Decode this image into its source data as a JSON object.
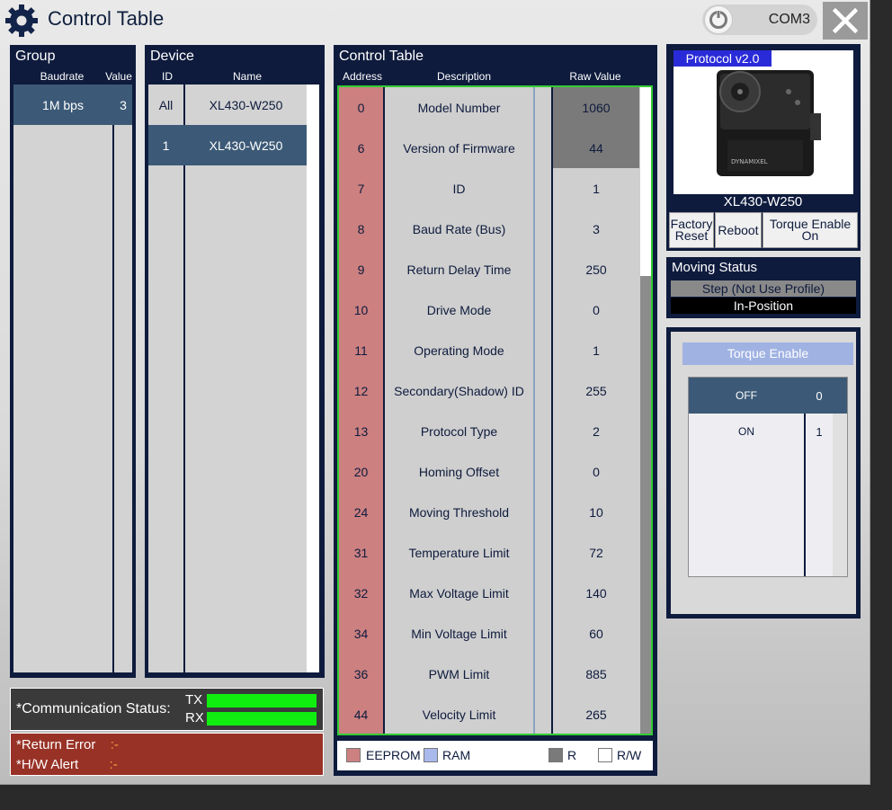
{
  "window": {
    "title": "Control Table"
  },
  "connection": {
    "port": "COM3"
  },
  "group": {
    "title": "Group",
    "col_baudrate": "Baudrate",
    "col_value": "Value",
    "rows": [
      {
        "baudrate": "1M bps",
        "value": "3"
      }
    ]
  },
  "device": {
    "title": "Device",
    "col_id": "ID",
    "col_name": "Name",
    "rows": [
      {
        "id": "All",
        "name": "XL430-W250"
      },
      {
        "id": "1",
        "name": "XL430-W250"
      }
    ]
  },
  "control_table": {
    "title": "Control Table",
    "col_address": "Address",
    "col_description": "Description",
    "col_raw": "Raw Value",
    "rows": [
      {
        "address": "0",
        "description": "Model Number",
        "raw": "1060",
        "access": "R"
      },
      {
        "address": "6",
        "description": "Version of Firmware",
        "raw": "44",
        "access": "R"
      },
      {
        "address": "7",
        "description": "ID",
        "raw": "1",
        "access": "R/W"
      },
      {
        "address": "8",
        "description": "Baud Rate (Bus)",
        "raw": "3",
        "access": "R/W"
      },
      {
        "address": "9",
        "description": "Return Delay Time",
        "raw": "250",
        "access": "R/W"
      },
      {
        "address": "10",
        "description": "Drive Mode",
        "raw": "0",
        "access": "R/W"
      },
      {
        "address": "11",
        "description": "Operating Mode",
        "raw": "1",
        "access": "R/W"
      },
      {
        "address": "12",
        "description": "Secondary(Shadow) ID",
        "raw": "255",
        "access": "R/W"
      },
      {
        "address": "13",
        "description": "Protocol Type",
        "raw": "2",
        "access": "R/W"
      },
      {
        "address": "20",
        "description": "Homing Offset",
        "raw": "0",
        "access": "R/W"
      },
      {
        "address": "24",
        "description": "Moving Threshold",
        "raw": "10",
        "access": "R/W"
      },
      {
        "address": "31",
        "description": "Temperature Limit",
        "raw": "72",
        "access": "R/W"
      },
      {
        "address": "32",
        "description": "Max Voltage Limit",
        "raw": "140",
        "access": "R/W"
      },
      {
        "address": "34",
        "description": "Min Voltage Limit",
        "raw": "60",
        "access": "R/W"
      },
      {
        "address": "36",
        "description": "PWM Limit",
        "raw": "885",
        "access": "R/W"
      },
      {
        "address": "44",
        "description": "Velocity Limit",
        "raw": "265",
        "access": "R/W"
      }
    ]
  },
  "legend": {
    "eeprom": "EEPROM",
    "ram": "RAM",
    "r": "R",
    "rw": "R/W"
  },
  "colors": {
    "eeprom": "#cc8080",
    "ram": "#a9b9ec",
    "readonly": "#7a7a7a",
    "accent": "#33cc33",
    "selection": "#3c5a77"
  },
  "comm_status": {
    "label": "*Communication Status:",
    "tx": "TX",
    "rx": "RX"
  },
  "errors": {
    "return_error_label": "*Return Error",
    "return_error_value": ":-",
    "hw_alert_label": "*H/W Alert",
    "hw_alert_value": ":-"
  },
  "device_info": {
    "protocol": "Protocol v2.0",
    "model": "XL430-W250",
    "factory_reset_line1": "Factory",
    "factory_reset_line2": "Reset",
    "reboot": "Reboot",
    "torque_line1": "Torque Enable",
    "torque_line2": "On"
  },
  "moving_status": {
    "title": "Moving Status",
    "profile": "Step (Not Use Profile)",
    "position": "In-Position"
  },
  "torque_panel": {
    "header": "Torque Enable",
    "options": [
      {
        "name": "OFF",
        "value": "0"
      },
      {
        "name": "ON",
        "value": "1"
      }
    ]
  },
  "icons": {
    "app": "gear-icon",
    "connection": "power-icon",
    "close": "close-icon"
  }
}
